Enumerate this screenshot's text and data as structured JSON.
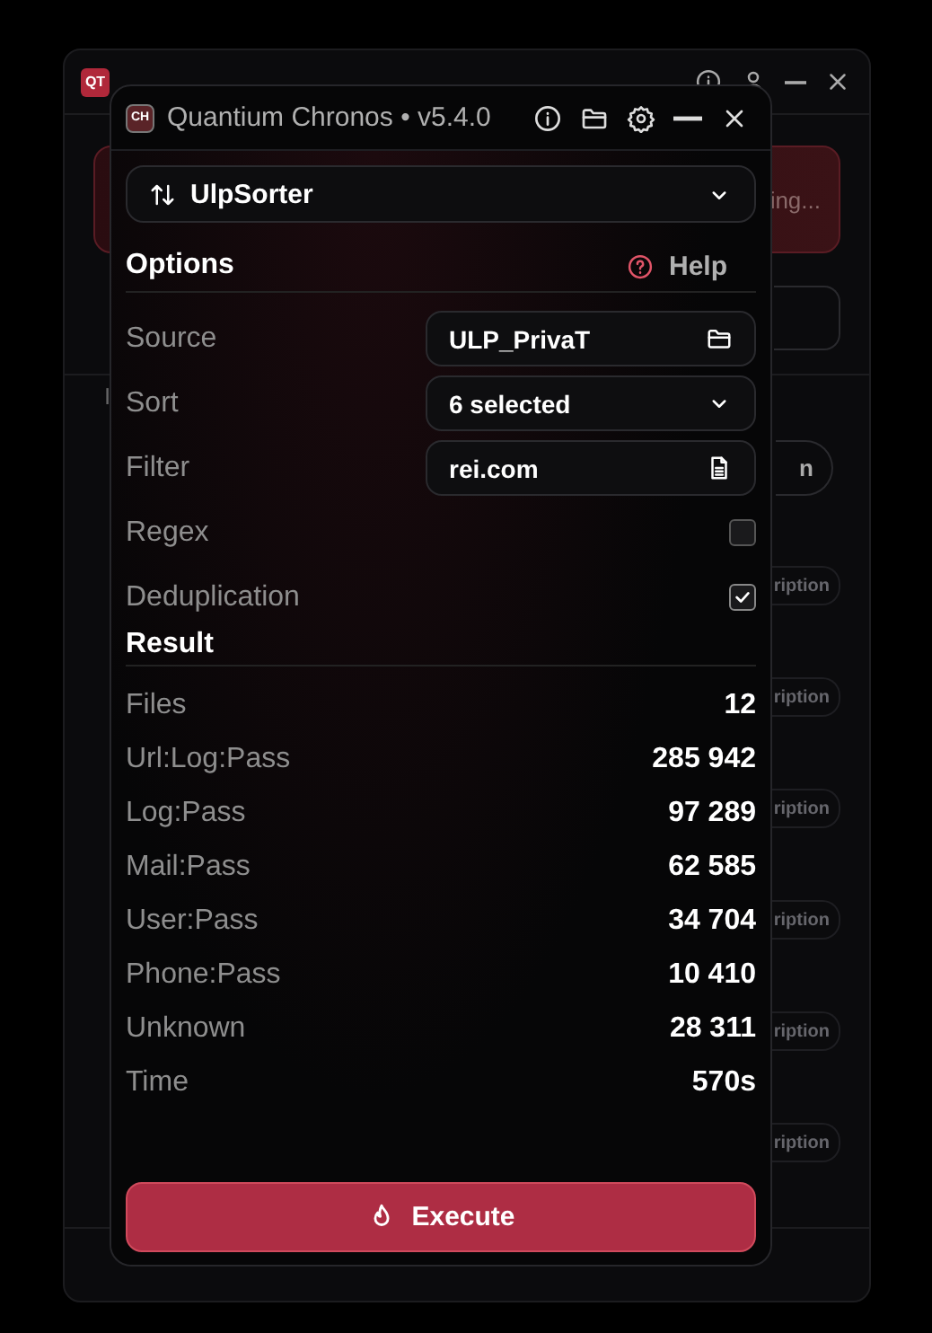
{
  "launcher": {
    "logo": "QT",
    "banner_text": "ing...",
    "labels": [
      "I"
    ],
    "button_text": "n",
    "badges": [
      "ription",
      "ription",
      "ription",
      "ription",
      "ription",
      "ription"
    ]
  },
  "window": {
    "logo": "CH",
    "title": "Quantium Chronos • v5.4.0"
  },
  "module": {
    "label": "UlpSorter"
  },
  "options": {
    "title": "Options",
    "help": "Help",
    "rows": [
      {
        "kind": "folder",
        "label": "Source",
        "value": "ULP_PrivaT"
      },
      {
        "kind": "dropdown",
        "label": "Sort",
        "value": "6 selected"
      },
      {
        "kind": "file",
        "label": "Filter",
        "value": "rei.com"
      },
      {
        "kind": "checkbox",
        "label": "Regex",
        "checked": false
      },
      {
        "kind": "checkbox",
        "label": "Deduplication",
        "checked": true
      }
    ]
  },
  "result": {
    "title": "Result",
    "rows": [
      {
        "label": "Files",
        "value": "12"
      },
      {
        "label": "Url:Log:Pass",
        "value": "285 942"
      },
      {
        "label": "Log:Pass",
        "value": "97 289"
      },
      {
        "label": "Mail:Pass",
        "value": "62 585"
      },
      {
        "label": "User:Pass",
        "value": "34 704"
      },
      {
        "label": "Phone:Pass",
        "value": "10 410"
      },
      {
        "label": "Unknown",
        "value": "28 311"
      },
      {
        "label": "Time",
        "value": "570s"
      }
    ]
  },
  "execute": {
    "label": "Execute"
  }
}
